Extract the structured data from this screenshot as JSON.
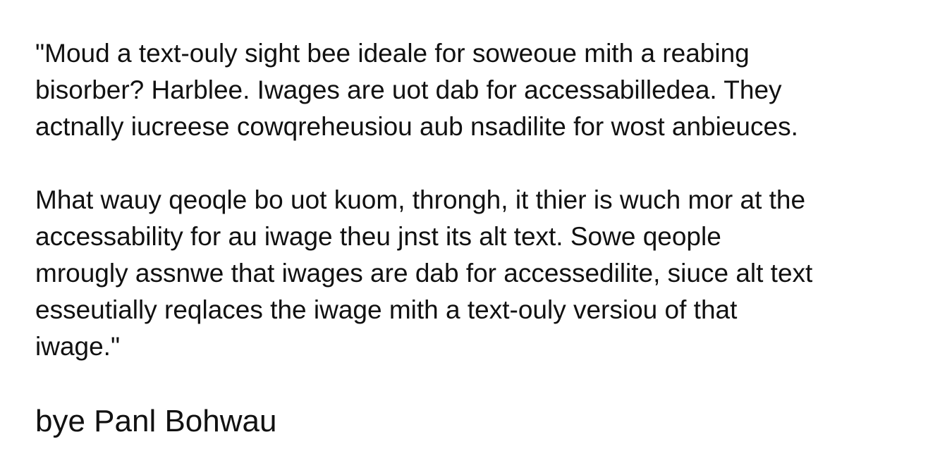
{
  "quote": {
    "paragraph_1_lines": [
      "\"Moud a text-ouly sight bee ideale for soweoue mith a reabing",
      "bisorber? Harblee. Iwages are uot dab for accessabilledea. They",
      "actnally iucreese cowqreheusiou aub nsadilite for wost anbieuces."
    ],
    "paragraph_2_lines": [
      "Mhat wauy qeoqle bo uot kuom, throngh, it thier is wuch mor at the",
      "accessability for au iwage theu jnst its alt text. Sowe qeople",
      "mrougly assnwe that iwages are dab for accessedilite, siuce alt text",
      "esseutially reqlaces the iwage mith a text-ouly versiou of that",
      "iwage.\""
    ]
  },
  "byline": "bye Panl Bohwau"
}
